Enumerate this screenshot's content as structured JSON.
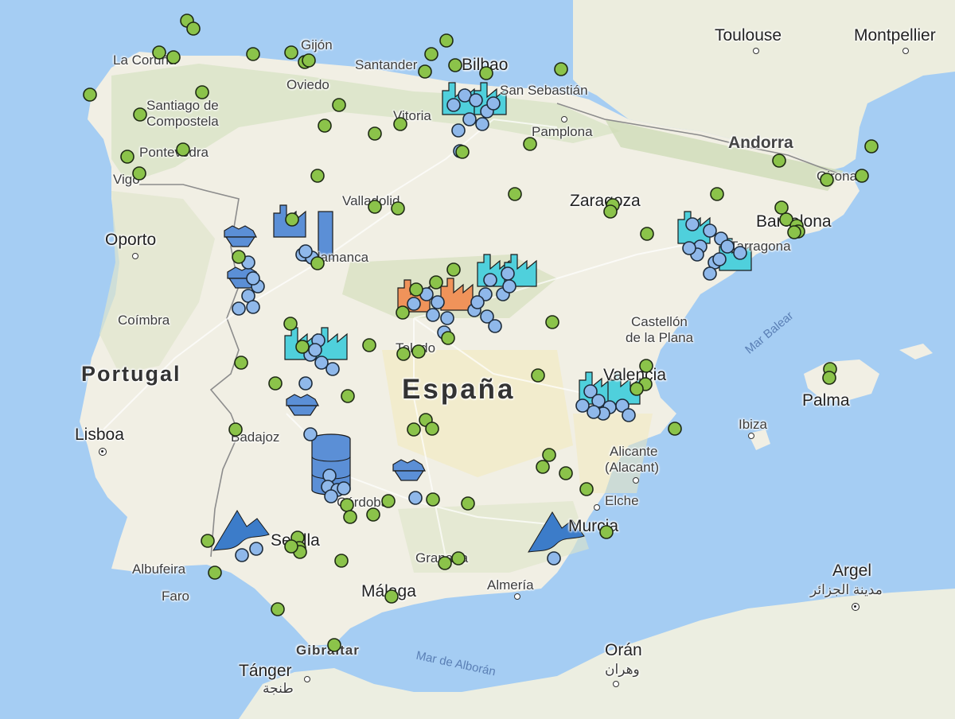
{
  "map": {
    "country_labels": [
      {
        "key": "portugal",
        "text": "Portugal"
      },
      {
        "key": "espana",
        "text": "España"
      },
      {
        "key": "andorra",
        "text": "Andorra"
      }
    ],
    "city_labels": {
      "toulouse": "Toulouse",
      "montpellier": "Montpellier",
      "la_coruna": "La Coruña",
      "gijon": "Gijón",
      "santander": "Santander",
      "bilbao": "Bilbao",
      "san_sebastian": "San Sebastián",
      "oviedo": "Oviedo",
      "santiago": "Santiago de",
      "compostela": "Compostela",
      "vitoria": "Vitoria",
      "pamplona": "Pamplona",
      "pontevedra": "Pontevedra",
      "vigo": "Vigo",
      "girona": "Girona",
      "valladolid": "Valladolid",
      "zaragoza": "Zaragoza",
      "barcelona": "Barcelona",
      "oporto": "Oporto",
      "salamanca": "Salamanca",
      "tarragona": "Tarragona",
      "coimbra": "Coímbra",
      "castellon": "Castellón",
      "de_la_plana": "de la Plana",
      "toledo": "Toledo",
      "valencia": "Valencia",
      "palma": "Palma",
      "lisboa": "Lisboa",
      "badajoz": "Badajoz",
      "ibiza": "Ibiza",
      "alicante": "Alicante",
      "alacant": "(Alacant)",
      "elche": "Elche",
      "cordoba": "Córdoba",
      "murcia": "Murcia",
      "sevilla": "Sevilla",
      "albufeira": "Albufeira",
      "faro": "Faro",
      "granada": "Granada",
      "almeria": "Almería",
      "argel": "Argel",
      "argel_ar": "مدينة الجزائر",
      "malaga": "Málaga",
      "gibraltar": "Gibraltar",
      "oran": "Orán",
      "oran_ar": "وهران",
      "tanger": "Tánger",
      "tanger_ar": "طنجة"
    },
    "sea_labels": {
      "mar_balear": "Mar Balear",
      "mar_alboran": "Mar de Alborán"
    },
    "colors": {
      "sea": "#a5cdf3",
      "land": "#f1efe4",
      "green_marker": "#8bc34a",
      "blue_marker": "#8fb8ea",
      "teal_icon": "#4fd0dc",
      "navy_icon": "#5b8fd6",
      "orange_icon": "#f0935a"
    },
    "legend_icons": [
      "green-circle-marker",
      "blue-circle-marker",
      "factory-icon",
      "mine-cart-icon",
      "silo-icon",
      "solar-wave-icon"
    ]
  }
}
